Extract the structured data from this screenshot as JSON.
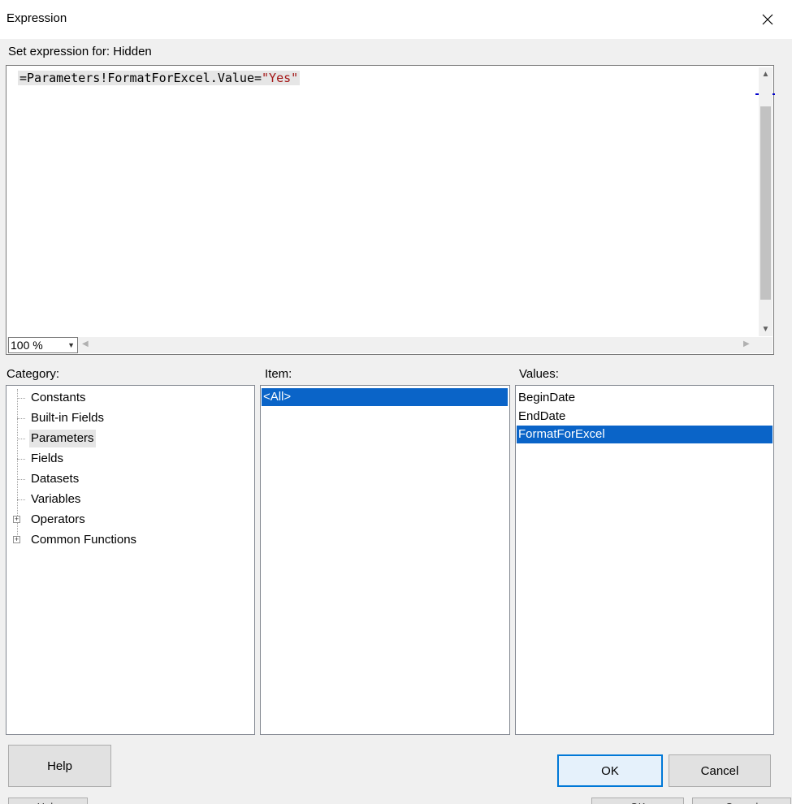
{
  "window": {
    "title": "Expression"
  },
  "set_label": "Set expression for: Hidden",
  "editor": {
    "code_prefix": "=Parameters!FormatForExcel.Value=",
    "code_string": "\"Yes\"",
    "zoom": "100 %"
  },
  "category": {
    "label": "Category:",
    "items": [
      "Constants",
      "Built-in Fields",
      "Parameters",
      "Fields",
      "Datasets",
      "Variables",
      "Operators",
      "Common Functions"
    ],
    "selected": "Parameters"
  },
  "item": {
    "label": "Item:",
    "items": [
      "<All>"
    ],
    "selected": "<All>"
  },
  "values": {
    "label": "Values:",
    "items": [
      "BeginDate",
      "EndDate",
      "FormatForExcel"
    ],
    "selected": "FormatForExcel"
  },
  "buttons": {
    "help": "Help",
    "ok": "OK",
    "cancel": "Cancel"
  },
  "ghost_buttons": {
    "help": "Help",
    "ok": "OK",
    "cancel": "Cancel"
  },
  "colors": {
    "selection": "#0a64c8",
    "string": "#a31515",
    "default_border": "#0078d7"
  }
}
